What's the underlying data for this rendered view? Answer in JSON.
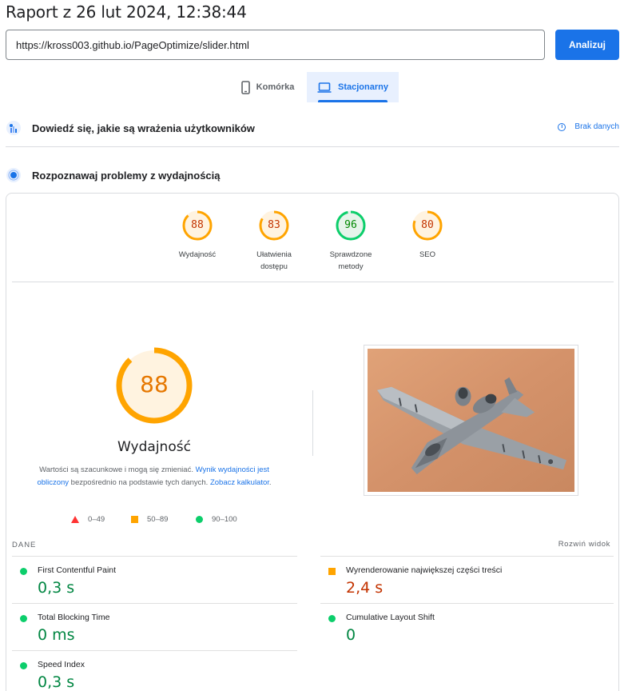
{
  "header": {
    "title": "Raport z 26 lut 2024, 12:38:44"
  },
  "search": {
    "url": "https://kross003.github.io/PageOptimize/slider.html",
    "analyze_label": "Analizuj"
  },
  "device_tabs": [
    {
      "label": "Komórka",
      "icon": "smartphone-icon",
      "active": false
    },
    {
      "label": "Stacjonarny",
      "icon": "laptop-icon",
      "active": true
    }
  ],
  "crux": {
    "title": "Dowiedź się, jakie są wrażenia użytkowników",
    "no_data": "Brak danych"
  },
  "diagnose": {
    "title": "Rozpoznawaj problemy z wydajnością"
  },
  "categories": [
    {
      "score": "88",
      "label_line1": "Wydajność",
      "label_line2": "",
      "color": "#ffa400",
      "text_color": "#c33300",
      "fill": "#fff3e0"
    },
    {
      "score": "83",
      "label_line1": "Ułatwienia",
      "label_line2": "dostępu",
      "color": "#ffa400",
      "text_color": "#c33300",
      "fill": "#fff3e0"
    },
    {
      "score": "96",
      "label_line1": "Sprawdzone",
      "label_line2": "metody",
      "color": "#0cce6b",
      "text_color": "#008800",
      "fill": "#e6f4ea"
    },
    {
      "score": "80",
      "label_line1": "SEO",
      "label_line2": "",
      "color": "#ffa400",
      "text_color": "#c33300",
      "fill": "#fff3e0"
    }
  ],
  "performance": {
    "score": "88",
    "label": "Wydajność",
    "desc_part1": "Wartości są szacunkowe i mogą się zmieniać. ",
    "desc_link1": "Wynik wydajności jest obliczony",
    "desc_part2": " bezpośrednio na podstawie tych danych. ",
    "desc_link2": "Zobacz kalkulator",
    "desc_part3": "."
  },
  "legend": [
    {
      "range": "0–49",
      "shape": "triangle",
      "color": "#ff3333"
    },
    {
      "range": "50–89",
      "shape": "square",
      "color": "#ffa400"
    },
    {
      "range": "90–100",
      "shape": "circle",
      "color": "#0cce6b"
    }
  ],
  "metrics_section": {
    "label": "DANE",
    "expand": "Rozwiń widok"
  },
  "metrics": [
    {
      "name": "First Contentful Paint",
      "value": "0,3 s",
      "status": "good"
    },
    {
      "name": "Wyrenderowanie największej części treści",
      "value": "2,4 s",
      "status": "average"
    },
    {
      "name": "Total Blocking Time",
      "value": "0 ms",
      "status": "good"
    },
    {
      "name": "Cumulative Layout Shift",
      "value": "0",
      "status": "good"
    },
    {
      "name": "Speed Index",
      "value": "0,3 s",
      "status": "good"
    }
  ]
}
